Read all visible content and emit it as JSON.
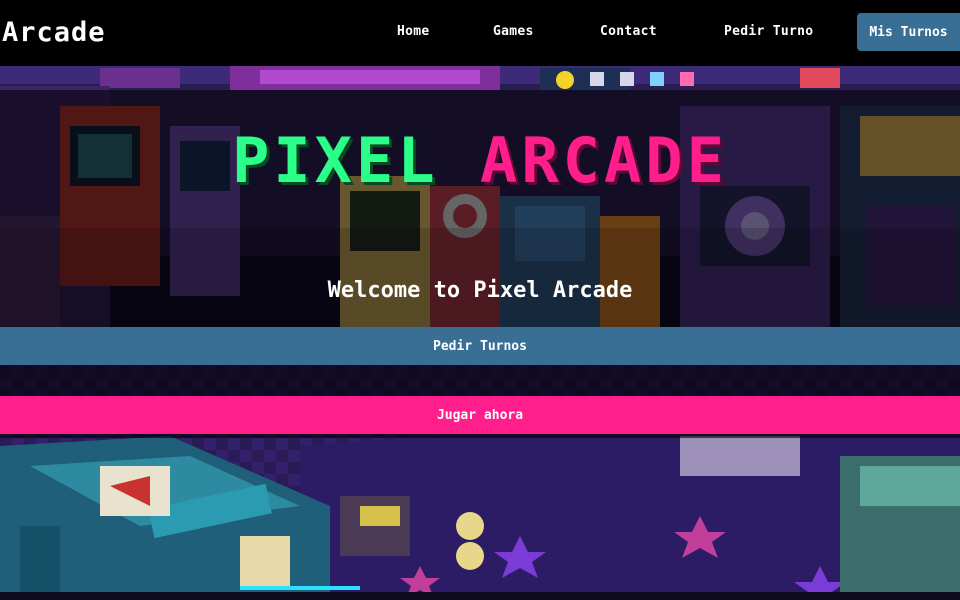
{
  "nav": {
    "brand": "Arcade",
    "links": {
      "home": "Home",
      "games": "Games",
      "contact": "Contact",
      "pedir": "Pedir Turno"
    },
    "cta": "Mis Turnos"
  },
  "hero": {
    "title_part1": "PIXEL",
    "title_part2": "ARCADE",
    "welcome": "Welcome to Pixel Arcade",
    "button_turnos": "Pedir Turnos",
    "button_jugar": "Jugar ahora"
  },
  "colors": {
    "nav_bg": "#000000",
    "primary_blue": "#3a6f95",
    "accent_pink": "#ff1e8c",
    "title_green": "#2bff8a"
  }
}
